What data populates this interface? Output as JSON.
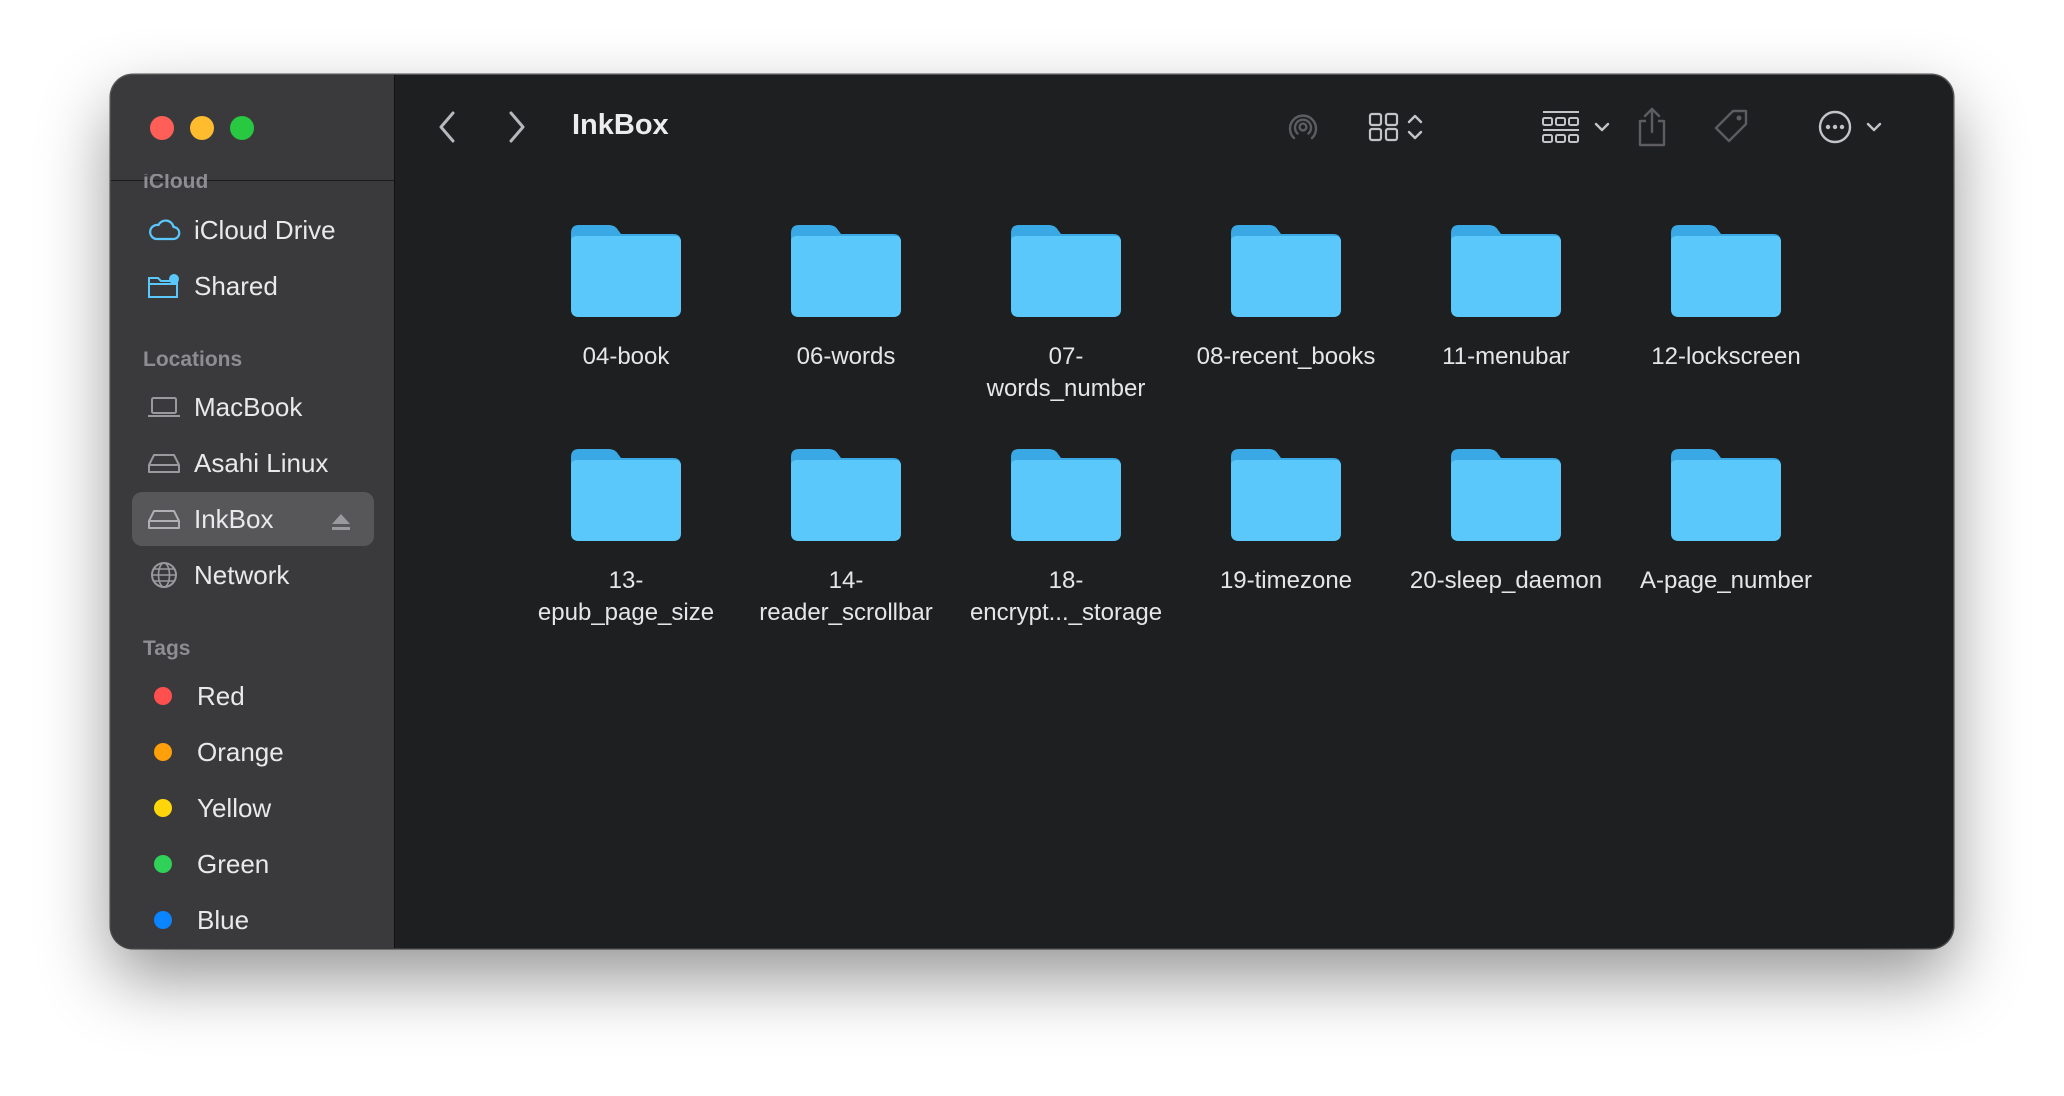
{
  "window": {
    "title": "InkBox"
  },
  "sidebar": {
    "partial_header": "iCloud",
    "icloud_items": [
      {
        "label": "iCloud Drive",
        "icon": "icloud-icon"
      },
      {
        "label": "Shared",
        "icon": "shared-folder-icon"
      }
    ],
    "locations_header": "Locations",
    "locations": [
      {
        "label": "MacBook",
        "icon": "laptop-icon"
      },
      {
        "label": "Asahi Linux",
        "icon": "drive-icon"
      },
      {
        "label": "InkBox",
        "icon": "drive-icon",
        "selected": true
      },
      {
        "label": "Network",
        "icon": "globe-icon"
      }
    ],
    "tags_header": "Tags",
    "tags": [
      {
        "label": "Red",
        "color": "#ff4f4f"
      },
      {
        "label": "Orange",
        "color": "#ff9f0a"
      },
      {
        "label": "Yellow",
        "color": "#ffd60a"
      },
      {
        "label": "Green",
        "color": "#30d158"
      },
      {
        "label": "Blue",
        "color": "#0a84ff"
      }
    ]
  },
  "folders": [
    {
      "name": "04-book"
    },
    {
      "name": "06-words"
    },
    {
      "name": "07-\nwords_number"
    },
    {
      "name": "08-recent_books"
    },
    {
      "name": "11-menubar"
    },
    {
      "name": "12-lockscreen"
    },
    {
      "name": "13-\nepub_page_size"
    },
    {
      "name": "14-\nreader_scrollbar"
    },
    {
      "name": "18-\nencrypt..._storage"
    },
    {
      "name": "19-timezone"
    },
    {
      "name": "20-sleep_daemon"
    },
    {
      "name": "A-page_number"
    }
  ],
  "colors": {
    "folder": "#5ac8fa",
    "folder_tab": "#44b4ea",
    "accent": "#0a84ff"
  }
}
